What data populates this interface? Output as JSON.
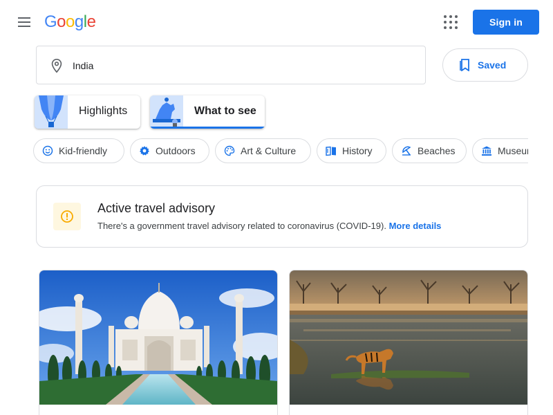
{
  "header": {
    "logo": [
      "G",
      "o",
      "o",
      "g",
      "l",
      "e"
    ],
    "logo_colors": [
      "#4285F4",
      "#EA4335",
      "#FBBC05",
      "#4285F4",
      "#34A853",
      "#EA4335"
    ],
    "sign_in_label": "Sign in"
  },
  "search": {
    "value": "India",
    "icon": "location-pin-icon"
  },
  "saved": {
    "label": "Saved",
    "icon": "bookmark-icon"
  },
  "tabs": [
    {
      "label": "Highlights",
      "active": false
    },
    {
      "label": "What to see",
      "active": true
    }
  ],
  "chips": [
    {
      "label": "Kid-friendly",
      "icon": "smiley-icon"
    },
    {
      "label": "Outdoors",
      "icon": "gear-icon"
    },
    {
      "label": "Art & Culture",
      "icon": "palette-icon"
    },
    {
      "label": "History",
      "icon": "book-icon"
    },
    {
      "label": "Beaches",
      "icon": "umbrella-icon"
    },
    {
      "label": "Museums",
      "icon": "museum-icon"
    }
  ],
  "advisory": {
    "title": "Active travel advisory",
    "text": "There's a government travel advisory related to coronavirus (COVID-19).",
    "link": "More details",
    "icon": "info-icon"
  },
  "cards": [
    {
      "image": "taj-mahal-photo"
    },
    {
      "image": "tiger-lake-photo"
    }
  ],
  "colors": {
    "accent": "#1a73e8",
    "border": "#dadce0",
    "advisory_icon_bg": "#fef7e0",
    "advisory_icon": "#f9ab00"
  }
}
